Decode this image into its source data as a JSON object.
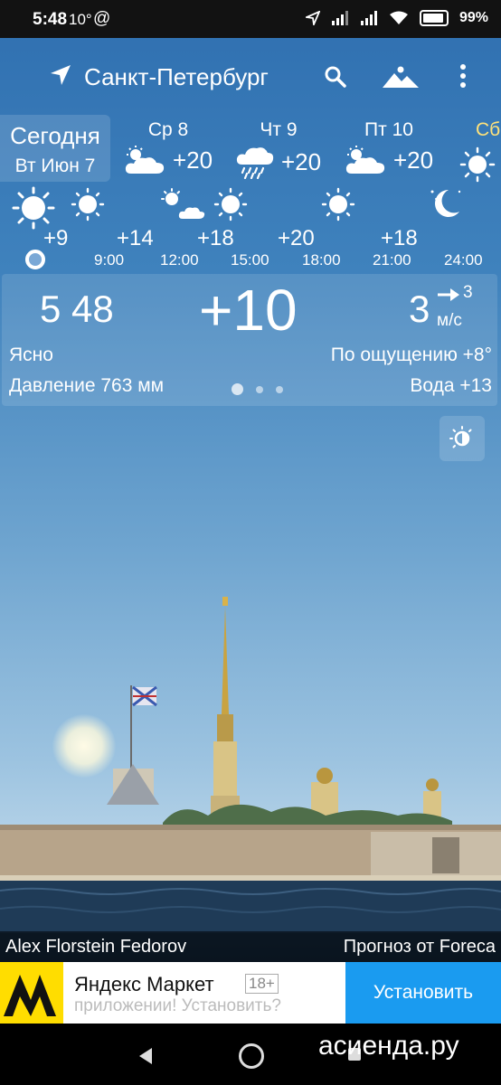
{
  "status": {
    "time": "5:48",
    "temp": "10°",
    "at": "@",
    "battery": "99%"
  },
  "header": {
    "city": "Санкт-Петербург"
  },
  "days": {
    "today_title": "Сегодня",
    "today_date": "Вт Июн 7",
    "items": [
      {
        "name": "Ср 8",
        "temp": "+20",
        "icon": "partly-cloudy-icon"
      },
      {
        "name": "Чт 9",
        "temp": "+20",
        "icon": "rain-icon"
      },
      {
        "name": "Пт 10",
        "temp": "+20",
        "icon": "partly-cloudy-icon"
      },
      {
        "name": "Сб",
        "temp": "",
        "icon": "sun-icon"
      }
    ]
  },
  "hourly": {
    "items": [
      {
        "time": "",
        "temp": "+9",
        "icon": "sun-icon"
      },
      {
        "time": "9:00",
        "temp": "+14",
        "icon": "sun-icon"
      },
      {
        "time": "12:00",
        "temp": "+18",
        "icon": "partly-cloudy-icon"
      },
      {
        "time": "15:00",
        "temp": "+20",
        "icon": "sun-icon"
      },
      {
        "time": "18:00",
        "temp": "",
        "icon": ""
      },
      {
        "time": "21:00",
        "temp": "+18",
        "icon": "sun-icon"
      },
      {
        "time": "24:00",
        "temp": "",
        "icon": "moon-icon"
      }
    ]
  },
  "current": {
    "time": "5 48",
    "temp": "+10",
    "wind_speed": "3",
    "wind_speed_small": "3",
    "wind_unit": "м/с",
    "condition": "Ясно",
    "feels_like": "По ощущению +8°",
    "pressure": "Давление 763 мм",
    "water": "Вода +13"
  },
  "credits": {
    "photo": "Alex Florstein Fedorov",
    "forecast": "Прогноз от Foreca"
  },
  "ad": {
    "title": "Яндекс Маркет",
    "age": "18+",
    "subtitle": "приложении! Установить?",
    "button": "Установить"
  },
  "watermark": "асиенда.ру",
  "colors": {
    "sky_top": "#2f6fb0",
    "ad_button": "#1a9bf0",
    "ad_logo": "#ffdd00"
  }
}
